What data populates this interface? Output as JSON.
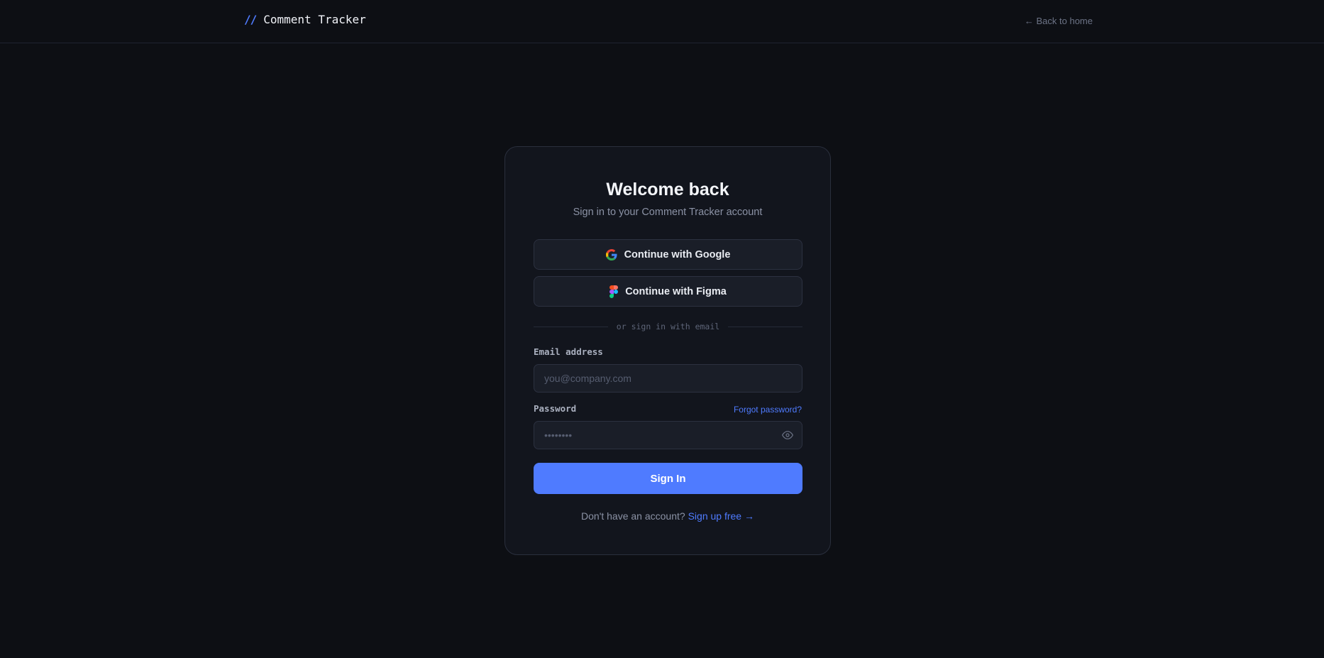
{
  "header": {
    "brand_mark": "//",
    "brand_name": "Comment Tracker",
    "back_link": "← Back to home"
  },
  "card": {
    "title": "Welcome back",
    "subtitle": "Sign in to your Comment Tracker account",
    "google_button": "Continue with Google",
    "figma_button": "Continue with Figma",
    "divider_text": "or sign in with email",
    "email_label": "Email address",
    "email_placeholder": "you@company.com",
    "email_value": "",
    "password_label": "Password",
    "password_placeholder": "••••••••",
    "password_value": "",
    "forgot_link": "Forgot password?",
    "signin_button": "Sign In",
    "signup_prompt": "Don't have an account?",
    "signup_link": "Sign up free →"
  },
  "icons": {
    "google": "google-logo-icon",
    "figma": "figma-logo-icon",
    "eye": "eye-icon"
  },
  "colors": {
    "accent": "#4f7bff",
    "background": "#0d0f14",
    "card": "#12151d"
  }
}
